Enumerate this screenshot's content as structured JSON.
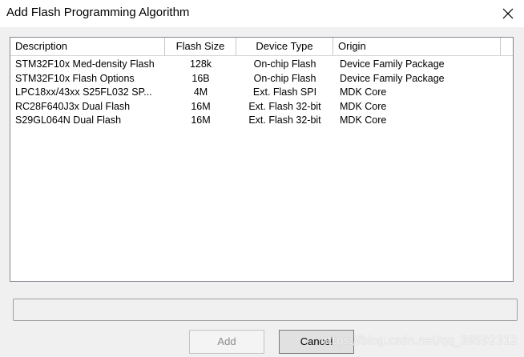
{
  "window": {
    "title": "Add Flash Programming Algorithm",
    "close_icon": "close-icon"
  },
  "table": {
    "columns": [
      "Description",
      "Flash Size",
      "Device Type",
      "Origin"
    ],
    "rows": [
      {
        "description": "STM32F10x Med-density Flash",
        "size": "128k",
        "type": "On-chip Flash",
        "origin": "Device Family Package"
      },
      {
        "description": "STM32F10x Flash Options",
        "size": "16B",
        "type": "On-chip Flash",
        "origin": "Device Family Package"
      },
      {
        "description": "LPC18xx/43xx S25FL032 SP...",
        "size": "4M",
        "type": "Ext. Flash SPI",
        "origin": "MDK Core"
      },
      {
        "description": "RC28F640J3x Dual Flash",
        "size": "16M",
        "type": "Ext. Flash 32-bit",
        "origin": "MDK Core"
      },
      {
        "description": "S29GL064N Dual Flash",
        "size": "16M",
        "type": "Ext. Flash 32-bit",
        "origin": "MDK Core"
      }
    ]
  },
  "status_text": "",
  "buttons": {
    "add": "Add",
    "cancel": "Cancel"
  },
  "watermark": "https://blog.csdn.net/qq_39592312"
}
